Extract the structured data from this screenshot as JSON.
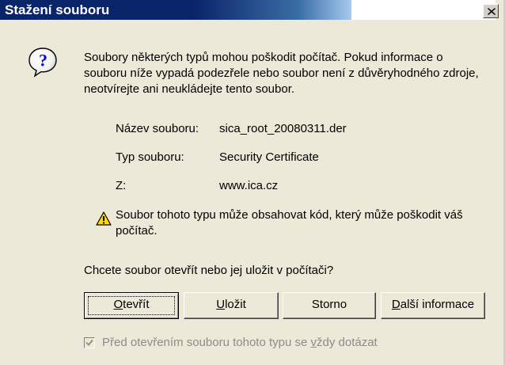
{
  "window": {
    "title": "Stažení souboru",
    "close_glyph": "×"
  },
  "dialog": {
    "intro_text": "Soubory některých typů mohou poškodit počítač. Pokud informace o souboru níže vypadá podezřele nebo soubor není z důvěryhodného zdroje, neotvírejte ani neukládejte tento soubor.",
    "details": {
      "name_label": "Název souboru:",
      "name_value": "sica_root_20080311.der",
      "type_label": "Typ souboru:",
      "type_value": "Security Certificate",
      "from_label": "Z:",
      "from_value": "www.ica.cz"
    },
    "warning_text": "Soubor tohoto typu může obsahovat kód, který může poškodit váš počítač.",
    "question_text": "Chcete soubor otevřít nebo jej uložit v počítači?",
    "buttons": {
      "open": {
        "mnemonic": "O",
        "rest": "tevřít"
      },
      "save": {
        "mnemonic": "U",
        "rest": "ložit"
      },
      "cancel": {
        "label": "Storno"
      },
      "more_info": {
        "mnemonic": "D",
        "rest": "alší informace"
      }
    },
    "checkbox": {
      "checked": true,
      "label_before": "Před otevřením souboru tohoto typu se ",
      "label_mnemonic": "v",
      "label_after": "ždy dotázat"
    }
  },
  "icons": {
    "question": "question-mark-icon",
    "warning": "warning-triangle-icon"
  },
  "colors": {
    "titlebar_start": "#0a246a",
    "titlebar_end": "#a6caf0",
    "dialog_bg": "#ece9d8",
    "disabled_text": "#8c8c8c"
  }
}
